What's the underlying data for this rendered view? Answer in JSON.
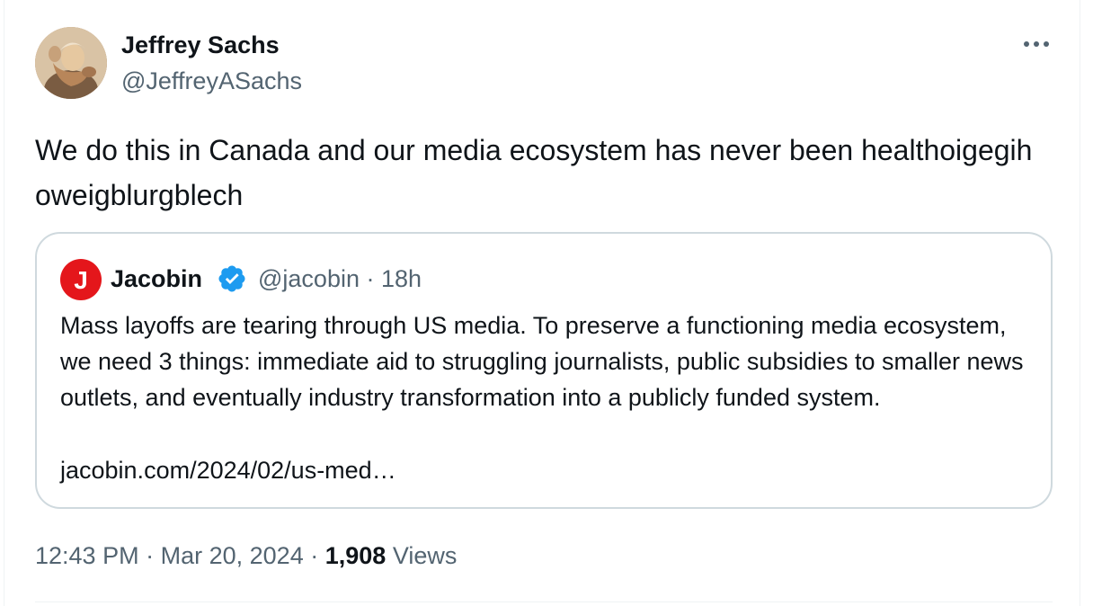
{
  "author": {
    "name": "Jeffrey Sachs",
    "handle": "@JeffreyASachs",
    "avatar_icon": "portrait-avatar-icon"
  },
  "tweet": {
    "text": "We do this in Canada and our media ecosystem has never been healthoigegihoweigblurgblech"
  },
  "more_icon": "more-options-icon",
  "quoted": {
    "logo_icon": "jacobin-logo-icon",
    "logo_letter": "J",
    "name": "Jacobin",
    "verified_icon": "verified-badge-icon",
    "handle": "@jacobin",
    "separator": "·",
    "age": "18h",
    "text": "Mass layoffs are tearing through US media. To preserve a functioning media ecosystem, we need 3 things: immediate aid to struggling journalists, public subsidies to smaller news outlets, and eventually industry transformation into a publicly funded system.",
    "link": "jacobin.com/2024/02/us-med…"
  },
  "meta": {
    "time": "12:43 PM",
    "separator": "·",
    "date": "Mar 20, 2024",
    "views_count": "1,908",
    "views_label": "Views"
  },
  "colors": {
    "text": "#0f1419",
    "secondary": "#536471",
    "border": "#cfd9de",
    "verified": "#1d9bf0",
    "jacobin_red": "#e4161b"
  }
}
